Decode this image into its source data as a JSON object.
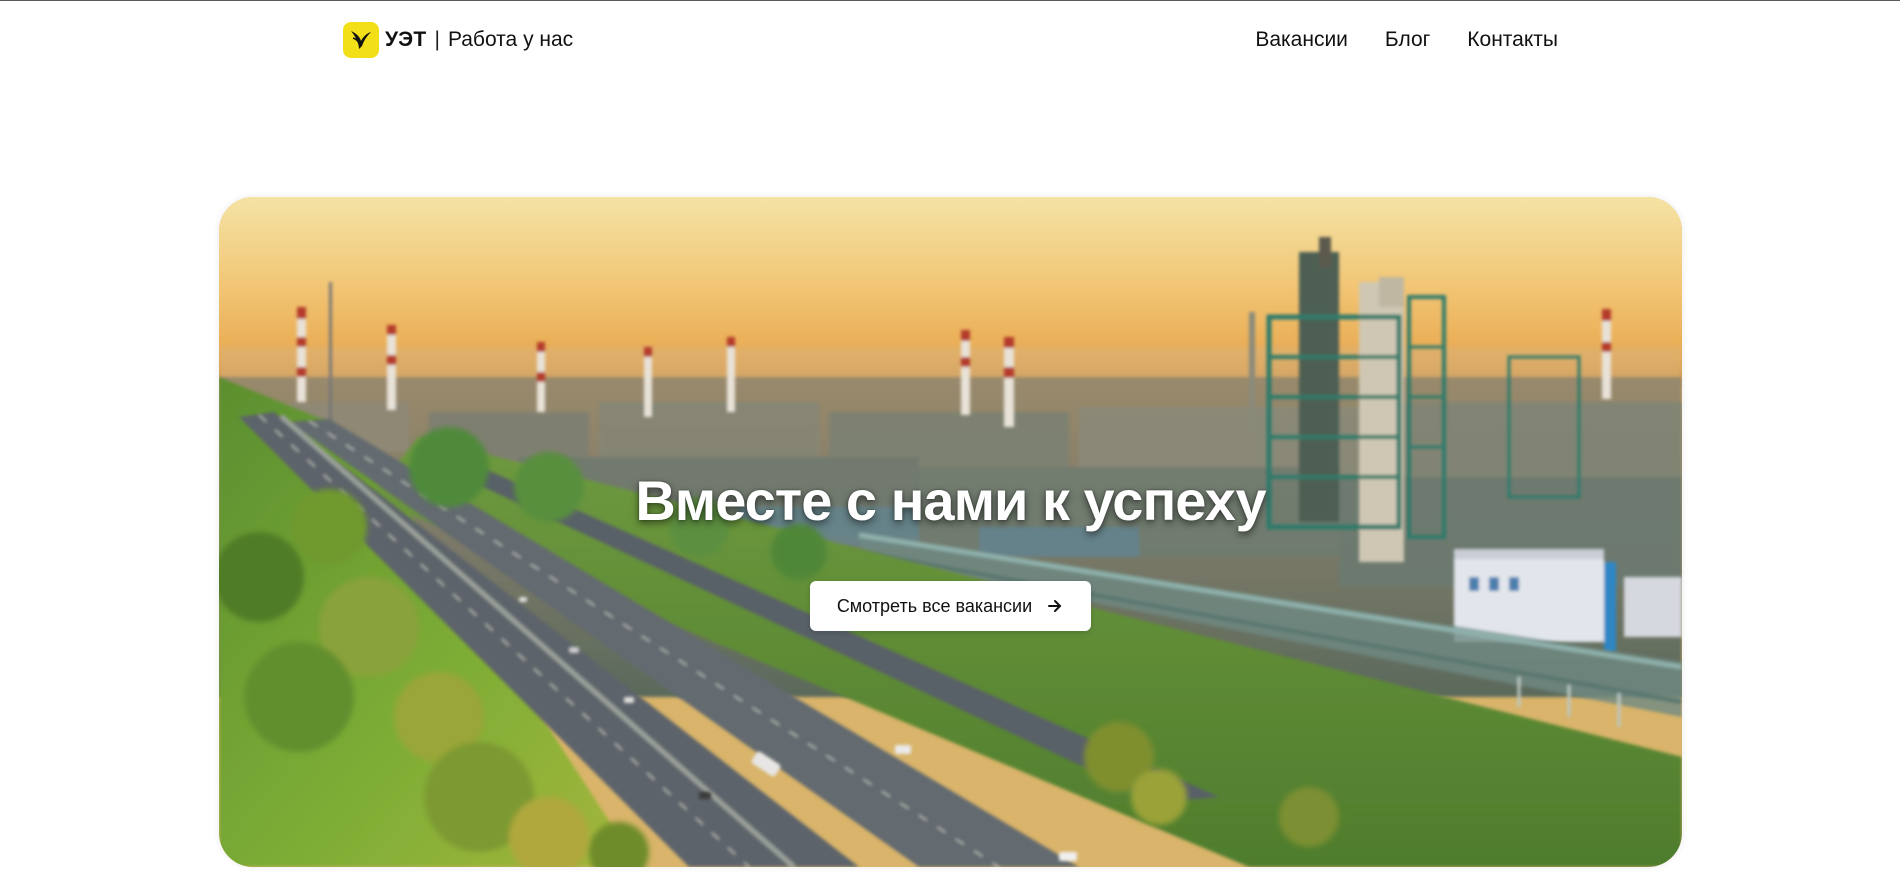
{
  "header": {
    "brand": "УЭТ",
    "separator": "|",
    "tagline": "Работа у нас",
    "logo_icon": "bird-icon",
    "nav": [
      {
        "label": "Вакансии"
      },
      {
        "label": "Блог"
      },
      {
        "label": "Контакты"
      }
    ]
  },
  "hero": {
    "title": "Вместе с нами к успеху",
    "button_label": "Смотреть все вакансии",
    "button_icon": "arrow-right-icon",
    "background_image": "oil-refinery-sunset-photo"
  },
  "colors": {
    "accent_yellow": "#f2df18",
    "text": "#111111",
    "background": "#ffffff"
  }
}
